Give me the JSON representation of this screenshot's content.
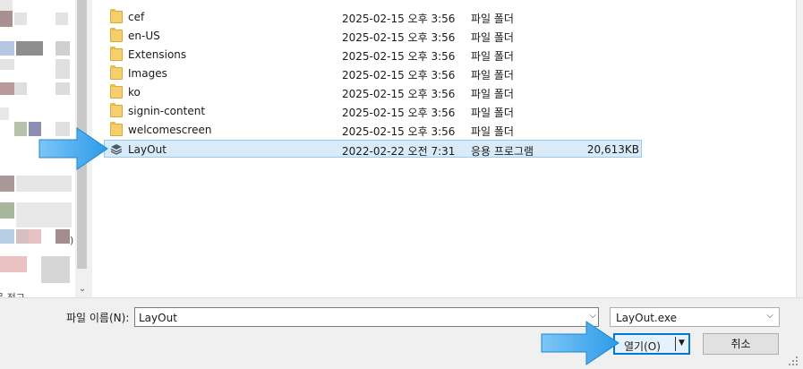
{
  "files": [
    {
      "name": "cef",
      "date": "2025-02-15 오후 3:56",
      "type": "파일 폴더",
      "size": "",
      "kind": "folder"
    },
    {
      "name": "en-US",
      "date": "2025-02-15 오후 3:56",
      "type": "파일 폴더",
      "size": "",
      "kind": "folder"
    },
    {
      "name": "Extensions",
      "date": "2025-02-15 오후 3:56",
      "type": "파일 폴더",
      "size": "",
      "kind": "folder"
    },
    {
      "name": "Images",
      "date": "2025-02-15 오후 3:56",
      "type": "파일 폴더",
      "size": "",
      "kind": "folder"
    },
    {
      "name": "ko",
      "date": "2025-02-15 오후 3:56",
      "type": "파일 폴더",
      "size": "",
      "kind": "folder"
    },
    {
      "name": "signin-content",
      "date": "2025-02-15 오후 3:56",
      "type": "파일 폴더",
      "size": "",
      "kind": "folder"
    },
    {
      "name": "welcomescreen",
      "date": "2025-02-15 오후 3:56",
      "type": "파일 폴더",
      "size": "",
      "kind": "folder"
    },
    {
      "name": "LayOut",
      "date": "2022-02-22 오전 7:31",
      "type": "응용 프로그램",
      "size": "20,613KB",
      "kind": "app",
      "selected": true
    }
  ],
  "filename": {
    "label": "파일 이름(N):",
    "value": "LayOut"
  },
  "filetype": {
    "value": "LayOut.exe"
  },
  "buttons": {
    "open": "열기(O)",
    "cancel": "취소"
  },
  "nav_fragments": {
    "bottom_text": "문 정고",
    "paren": ")"
  },
  "colors": {
    "accent": "#0078d7",
    "selected_bg": "#d9ebf9",
    "annotation_arrow": "#3aa7f0"
  }
}
